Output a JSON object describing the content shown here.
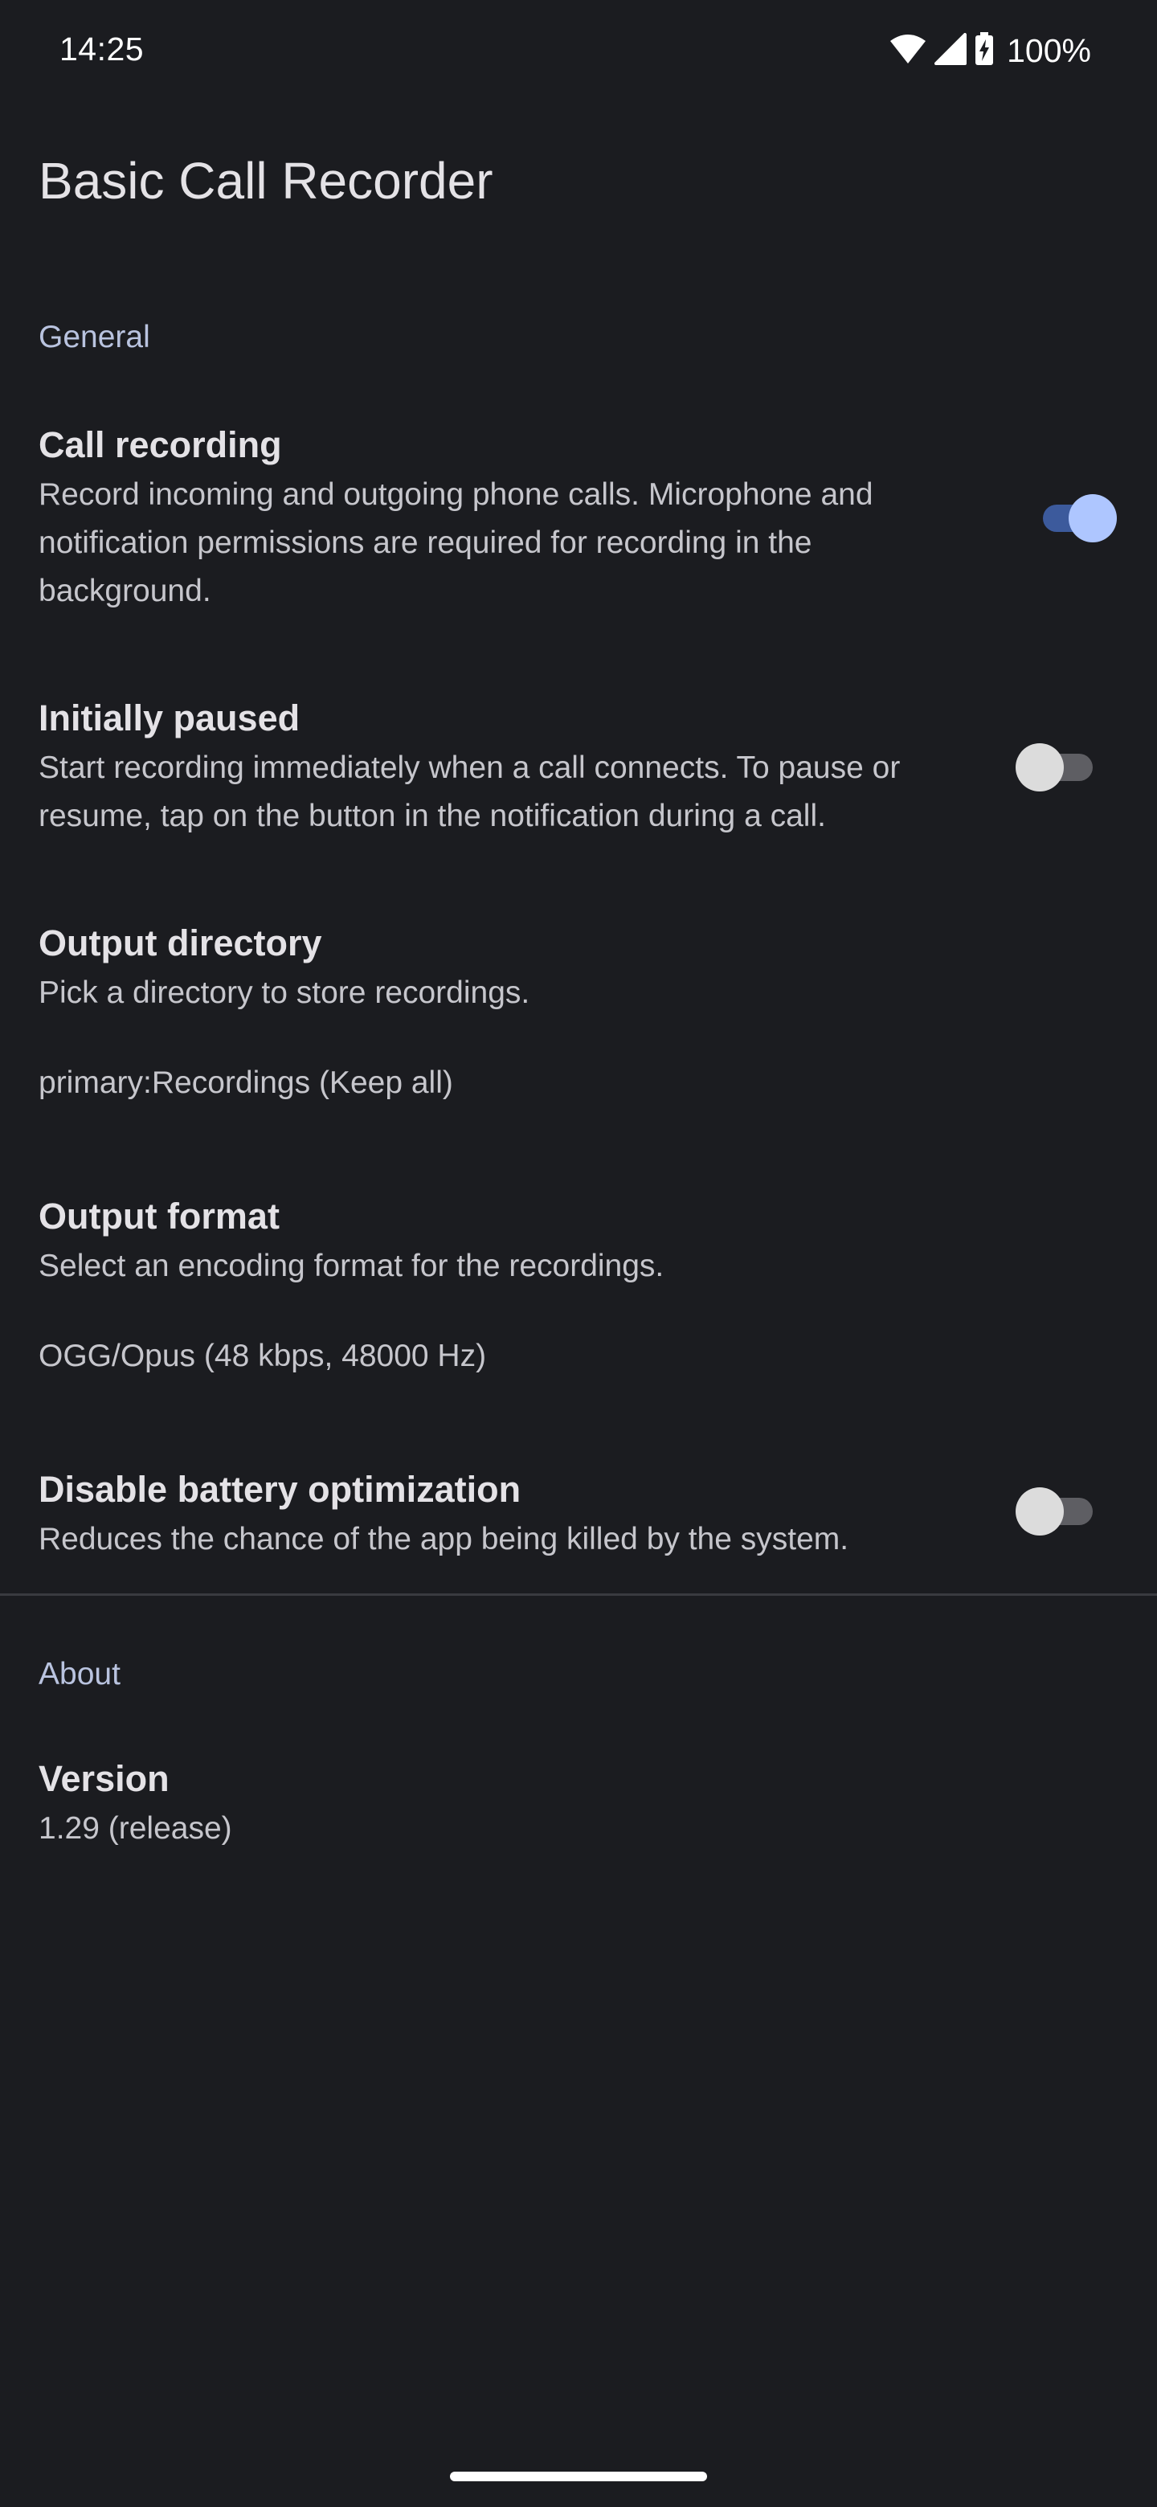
{
  "status_bar": {
    "time": "14:25",
    "battery": "100%",
    "icons": [
      "wifi-icon",
      "cell-signal-icon",
      "battery-charging-icon"
    ]
  },
  "app": {
    "title": "Basic Call Recorder"
  },
  "sections": {
    "general": {
      "header": "General"
    },
    "about": {
      "header": "About"
    }
  },
  "prefs": {
    "call_recording": {
      "title": "Call recording",
      "summary": "Record incoming and outgoing phone calls. Microphone and notification permissions are required for recording in the background.",
      "enabled": true
    },
    "initially_paused": {
      "title": "Initially paused",
      "summary": "Start recording immediately when a call connects. To pause or resume, tap on the button in the notification during a call.",
      "enabled": false
    },
    "output_directory": {
      "title": "Output directory",
      "summary": "Pick a directory to store recordings.",
      "value": "primary:Recordings (Keep all)"
    },
    "output_format": {
      "title": "Output format",
      "summary": "Select an encoding format for the recordings.",
      "value": "OGG/Opus (48 kbps, 48000 Hz)"
    },
    "battery_optimization": {
      "title": "Disable battery optimization",
      "summary": "Reduces the chance of the app being killed by the system.",
      "enabled": false
    },
    "version": {
      "title": "Version",
      "summary": "1.29 (release)"
    }
  },
  "colors": {
    "background": "#1b1c20",
    "accent": "#aec6ff",
    "section_header": "#b9c3df"
  }
}
